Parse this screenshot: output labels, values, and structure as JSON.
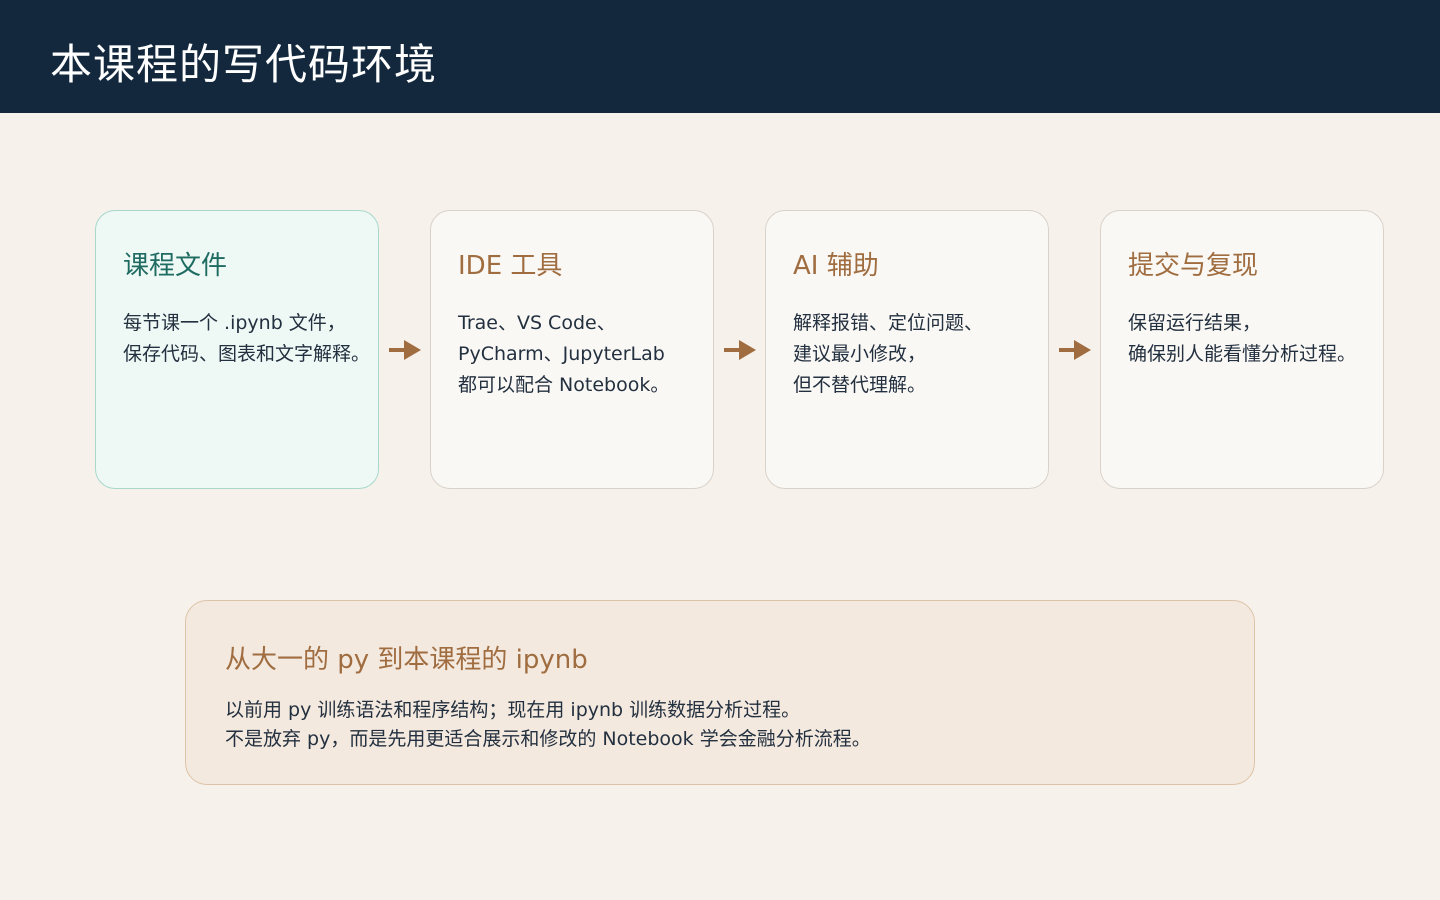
{
  "header": {
    "title": "本课程的写代码环境"
  },
  "cards": [
    {
      "title": "课程文件",
      "lines": [
        "每节课一个 .ipynb 文件，",
        "保存代码、图表和文字解释。"
      ]
    },
    {
      "title": "IDE 工具",
      "lines": [
        "Trae、VS Code、",
        "PyCharm、JupyterLab",
        "都可以配合 Notebook。"
      ]
    },
    {
      "title": "AI 辅助",
      "lines": [
        "解释报错、定位问题、",
        "建议最小修改，",
        "但不替代理解。"
      ]
    },
    {
      "title": "提交与复现",
      "lines": [
        "保留运行结果，",
        "确保别人能看懂分析过程。"
      ]
    }
  ],
  "summary": {
    "title": "从大一的 py 到本课程的 ipynb",
    "lines": [
      "以前用 py 训练语法和程序结构；现在用 ipynb 训练数据分析过程。",
      "不是放弃 py，而是先用更适合展示和修改的 Notebook 学会金融分析流程。"
    ]
  },
  "colors": {
    "header_bg": "#13283d",
    "page_bg": "#f6f1eb",
    "accent": "#a06d40",
    "highlight_title": "#1f6b62",
    "arrow": "#a06d40"
  }
}
